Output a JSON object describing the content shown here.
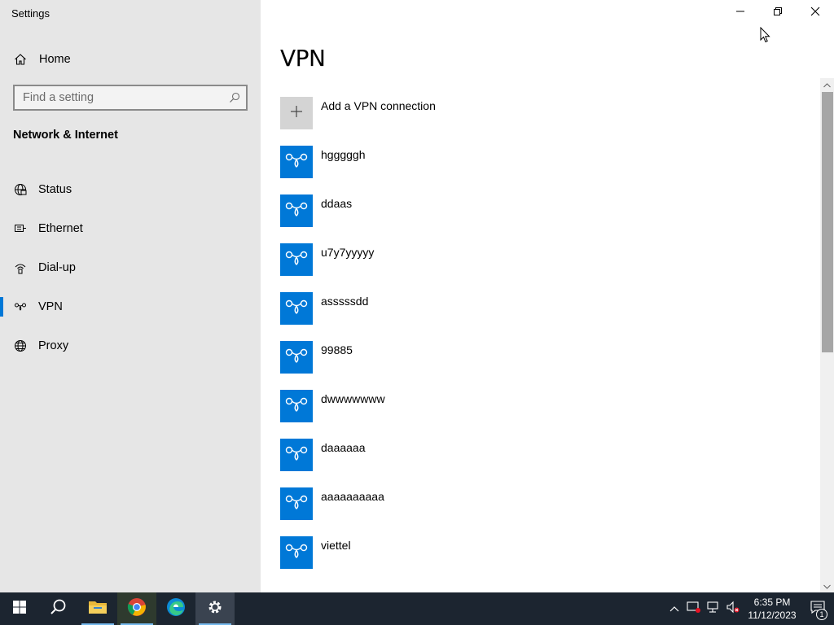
{
  "app": {
    "title": "Settings"
  },
  "colors": {
    "accent": "#0078d7",
    "sidebar_bg": "#e6e6e6",
    "taskbar_bg": "#1c2530"
  },
  "sidebar": {
    "home_label": "Home",
    "search_placeholder": "Find a setting",
    "section_title": "Network & Internet",
    "items": [
      {
        "label": "Status",
        "icon": "globe-status-icon",
        "active": false
      },
      {
        "label": "Ethernet",
        "icon": "ethernet-icon",
        "active": false
      },
      {
        "label": "Dial-up",
        "icon": "dialup-icon",
        "active": false
      },
      {
        "label": "VPN",
        "icon": "vpn-icon",
        "active": true
      },
      {
        "label": "Proxy",
        "icon": "globe-icon",
        "active": false
      }
    ]
  },
  "main": {
    "title": "VPN",
    "add_label": "Add a VPN connection",
    "connections": [
      {
        "name": "hgggggh"
      },
      {
        "name": "ddaas"
      },
      {
        "name": "u7y7yyyyy"
      },
      {
        "name": "asssssdd"
      },
      {
        "name": "99885"
      },
      {
        "name": "dwwwwwww"
      },
      {
        "name": "daaaaaa"
      },
      {
        "name": "aaaaaaaaaa"
      },
      {
        "name": "viettel"
      }
    ]
  },
  "taskbar": {
    "time": "6:35 PM",
    "date": "11/12/2023",
    "notification_count": "1",
    "apps": [
      "start-icon",
      "search-icon",
      "file-explorer-icon",
      "chrome-icon",
      "edge-icon",
      "settings-gear-icon"
    ]
  }
}
